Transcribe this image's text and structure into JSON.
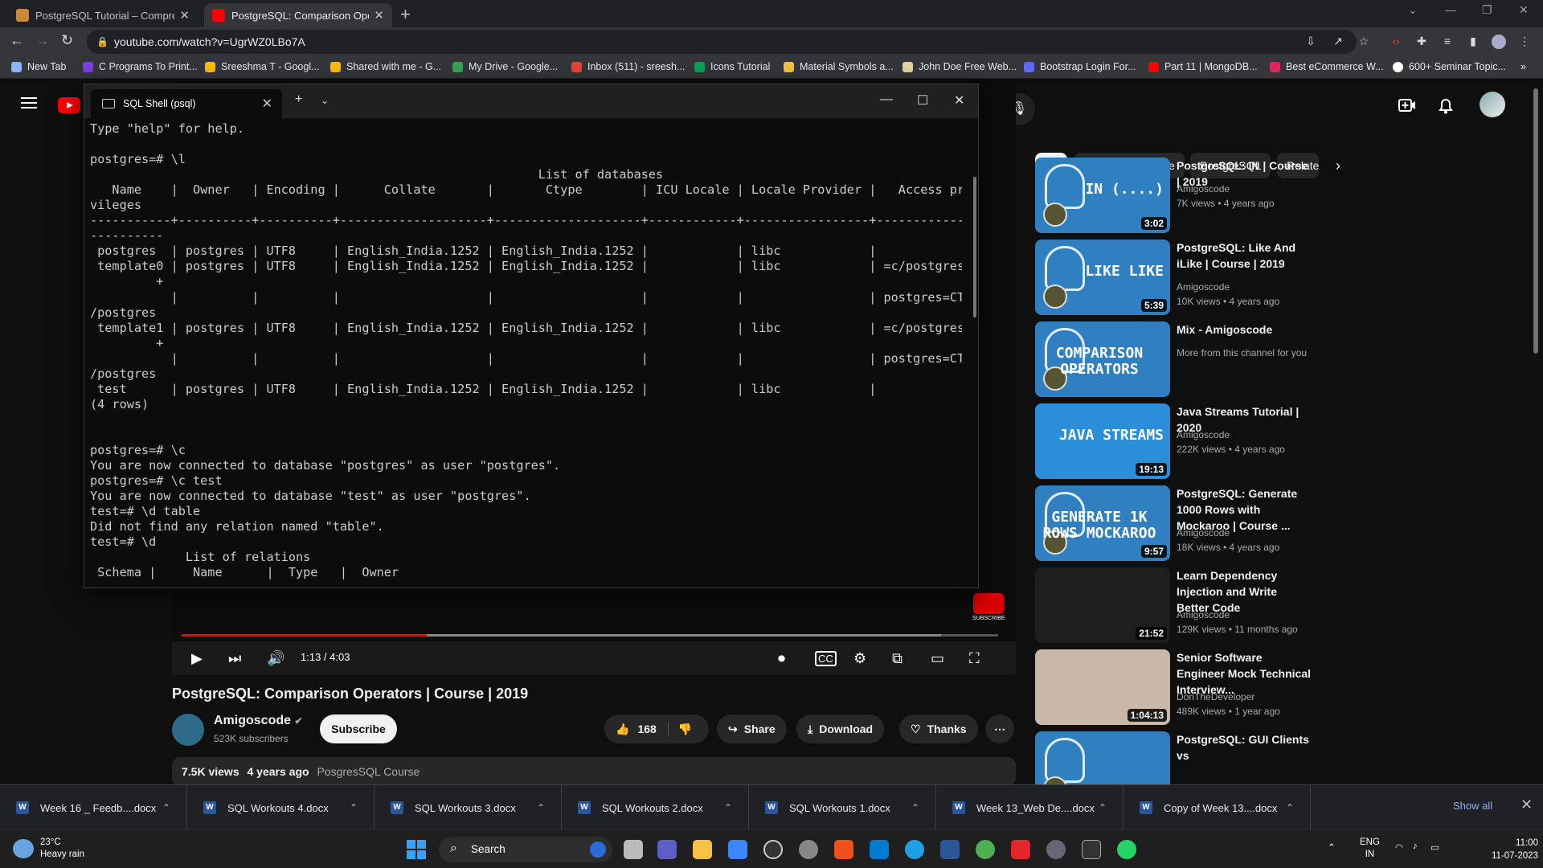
{
  "browser": {
    "tabs": [
      {
        "title": "PostgreSQL Tutorial – Comprehe",
        "active": false
      },
      {
        "title": "PostgreSQL: Comparison Operat",
        "active": true
      }
    ],
    "url": "youtube.com/watch?v=UgrWZ0LBo7A",
    "bookmarks": [
      {
        "label": "New Tab",
        "color": "#8ab4f8"
      },
      {
        "label": "C Programs To Print...",
        "color": "#7b3fe4"
      },
      {
        "label": "Sreeshma T - Googl...",
        "color": "#fbbc04"
      },
      {
        "label": "Shared with me - G...",
        "color": "#fbbc04"
      },
      {
        "label": "My Drive - Google...",
        "color": "#34a853"
      },
      {
        "label": "Inbox (511) - sreesh...",
        "color": "#ea4335"
      },
      {
        "label": "Icons Tutorial",
        "color": "#0f9d58"
      },
      {
        "label": "Material Symbols a...",
        "color": "#f5c242"
      },
      {
        "label": "John Doe Free Web...",
        "color": "#e8d3a0"
      },
      {
        "label": "Bootstrap Login For...",
        "color": "#5b6af0"
      },
      {
        "label": "Part 11 | MongoDB...",
        "color": "#ff0000"
      },
      {
        "label": "Best eCommerce W...",
        "color": "#e0245e"
      },
      {
        "label": "600+ Seminar Topic...",
        "color": "#ffffff"
      }
    ]
  },
  "terminal": {
    "tab_title": "SQL Shell (psql)",
    "lines": [
      "Type \"help\" for help.",
      "",
      "postgres=# \\l",
      "                                                             List of databases",
      "   Name    |  Owner   | Encoding |      Collate       |       Ctype        | ICU Locale | Locale Provider |   Access pri",
      "vileges",
      "-----------+----------+----------+--------------------+--------------------+------------+-----------------+-------------",
      "----------",
      " postgres  | postgres | UTF8     | English_India.1252 | English_India.1252 |            | libc            |",
      " template0 | postgres | UTF8     | English_India.1252 | English_India.1252 |            | libc            | =c/postgres",
      "         +",
      "           |          |          |                    |                    |            |                 | postgres=CTc",
      "/postgres",
      " template1 | postgres | UTF8     | English_India.1252 | English_India.1252 |            | libc            | =c/postgres",
      "         +",
      "           |          |          |                    |                    |            |                 | postgres=CTc",
      "/postgres",
      " test      | postgres | UTF8     | English_India.1252 | English_India.1252 |            | libc            |",
      "(4 rows)",
      "",
      "",
      "postgres=# \\c",
      "You are now connected to database \"postgres\" as user \"postgres\".",
      "postgres=# \\c test",
      "You are now connected to database \"test\" as user \"postgres\".",
      "test=# \\d table",
      "Did not find any relation named \"table\".",
      "test=# \\d",
      "             List of relations",
      " Schema |     Name      |  Type   |  Owner"
    ]
  },
  "player": {
    "time": "1:13 / 4:03",
    "progress": 0.3,
    "buffered": 0.93,
    "subscribe_watermark": "SUBSCRIBE"
  },
  "video": {
    "title": "PostgreSQL: Comparison Operators | Course | 2019",
    "channel": "Amigoscode",
    "subscribers": "523K subscribers",
    "subscribe": "Subscribe",
    "likes": "168",
    "share": "Share",
    "download": "Download",
    "thanks": "Thanks",
    "views": "7.5K views",
    "age": "4 years ago",
    "playlist": "PosgresSQL Course"
  },
  "chips": [
    "All",
    "From Amigoscode",
    "PostgreSQL",
    "Relate"
  ],
  "recommendations": [
    {
      "title": "PostgreSQL: IN | Course | 2019",
      "channel": "Amigoscode",
      "meta": "7K views • 4 years ago",
      "duration": "3:02",
      "thumb_text": "IN (....)",
      "bg": "#2f7fc1"
    },
    {
      "title": "PostgreSQL: Like And iLike | Course | 2019",
      "channel": "Amigoscode",
      "meta": "10K views • 4 years ago",
      "duration": "5:39",
      "thumb_text": "LIKE LIKE",
      "bg": "#2f7fc1"
    },
    {
      "title": "Mix - Amigoscode",
      "channel": "More from this channel for you",
      "meta": "",
      "duration": "",
      "thumb_text": "COMPARISON OPERATORS",
      "bg": "#2f7fc1"
    },
    {
      "title": "Java Streams Tutorial | 2020",
      "channel": "Amigoscode",
      "meta": "222K views • 4 years ago",
      "duration": "19:13",
      "thumb_text": "JAVA STREAMS",
      "bg": "#2a8fd8"
    },
    {
      "title": "PostgreSQL: Generate 1000 Rows with Mockaroo | Course ...",
      "channel": "Amigoscode",
      "meta": "18K views • 4 years ago",
      "duration": "9:57",
      "thumb_text": "GENERATE 1K ROWS MOCKAROO",
      "bg": "#2f7fc1"
    },
    {
      "title": "Learn Dependency Injection and Write Better Code",
      "channel": "Amigoscode",
      "meta": "129K views • 11 months ago",
      "duration": "21:52",
      "thumb_text": "",
      "bg": "#1e1e1e"
    },
    {
      "title": "Senior Software Engineer Mock Technical Interview...",
      "channel": "DonTheDeveloper",
      "meta": "489K views • 1 year ago",
      "duration": "1:04:13",
      "thumb_text": "",
      "bg": "#c9b8a8"
    },
    {
      "title": "PostgreSQL: GUI Clients vs",
      "channel": "",
      "meta": "",
      "duration": "",
      "thumb_text": "",
      "bg": "#2f7fc1"
    }
  ],
  "downloads": [
    "Week 16 _ Feedb....docx",
    "SQL Workouts 4.docx",
    "SQL Workouts 3.docx",
    "SQL Workouts 2.docx",
    "SQL Workouts 1.docx",
    "Week 13_Web De....docx",
    "Copy of Week 13....docx"
  ],
  "downloads_show_all": "Show all",
  "taskbar": {
    "temp": "23°C",
    "weather": "Heavy rain",
    "search": "Search",
    "lang1": "ENG",
    "lang2": "IN",
    "time": "11:00",
    "date": "11-07-2023"
  }
}
